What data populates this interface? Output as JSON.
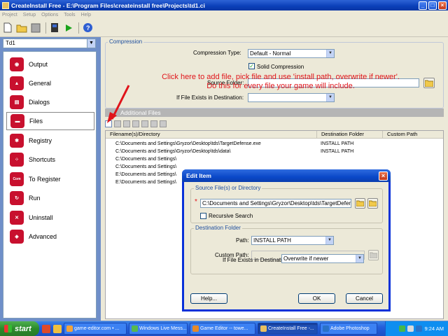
{
  "window": {
    "title": "CreateInstall Free - E:\\Program Files\\createinstall free\\Projects\\td1.ci",
    "minimize": "_",
    "maximize": "□",
    "close": "×"
  },
  "menu": [
    "Project",
    "Setup",
    "Options",
    "Tools",
    "Help"
  ],
  "project_select": {
    "value": "Td1"
  },
  "nav": [
    {
      "label": "Output",
      "icon": "output-icon",
      "color": "#c8102e"
    },
    {
      "label": "General",
      "icon": "general-icon",
      "color": "#c8102e"
    },
    {
      "label": "Dialogs",
      "icon": "dialogs-icon",
      "color": "#c8102e"
    },
    {
      "label": "Files",
      "icon": "files-icon",
      "color": "#c8102e"
    },
    {
      "label": "Registry",
      "icon": "registry-icon",
      "color": "#c8102e"
    },
    {
      "label": "Shortcuts",
      "icon": "shortcuts-icon",
      "color": "#c8102e"
    },
    {
      "label": "To Register",
      "icon": "to-register-icon",
      "color": "#c8102e"
    },
    {
      "label": "Run",
      "icon": "run-icon",
      "color": "#c8102e"
    },
    {
      "label": "Uninstall",
      "icon": "uninstall-icon",
      "color": "#c8102e"
    },
    {
      "label": "Advanced",
      "icon": "advanced-icon",
      "color": "#c8102e"
    }
  ],
  "compression": {
    "legend": "Compression",
    "type_label": "Compression Type:",
    "type_value": "Default - Normal",
    "solid_label": "Solid Compression",
    "solid_checked": "✓",
    "source_folder_label": "Source Folder:",
    "if_exists_label": "If File Exists in Destination:",
    "if_exists_value": ""
  },
  "annotation": {
    "line1": "Click here to add file, pick file and use 'install path, overwrite if newer'.",
    "line2": "Do this for every file your game will include."
  },
  "additional_files": {
    "header": "Additional Files",
    "columns": [
      "Filename(s)/Directory",
      "Destination Folder",
      "Custom Path"
    ],
    "rows": [
      [
        "C:\\Documents and Settings\\Gryzor\\Desktop\\tds\\TargetDefense.exe",
        "INSTALL PATH",
        ""
      ],
      [
        "C:\\Documents and Settings\\Gryzor\\Desktop\\tds\\data\\",
        "INSTALL PATH",
        ""
      ],
      [
        "C:\\Documents and Settings\\",
        "",
        ""
      ],
      [
        "C:\\Documents and Settings\\",
        "",
        ""
      ],
      [
        "E:\\Documents and Settings\\",
        "",
        ""
      ],
      [
        "E:\\Documents and Settings\\",
        "",
        ""
      ]
    ]
  },
  "dialog": {
    "title": "Edit Item",
    "close": "×",
    "source_legend": "Source File(s) or Directory",
    "required_mark": "*",
    "source_value": "C:\\Documents and Settings\\Gryzor\\Desktop\\tds\\TargetDefens",
    "recursive_label": "Recursive Search",
    "dest_legend": "Destination Folder",
    "path_label": "Path:",
    "path_value": "INSTALL PATH",
    "custom_path_label": "Custom Path:",
    "if_exists_label": "If File Exists in Destination",
    "if_exists_value": "Overwrite if newer",
    "help": "Help...",
    "ok": "OK",
    "cancel": "Cancel"
  },
  "taskbar": {
    "start": "start",
    "tasks": [
      {
        "label": "game-editor.com • ...",
        "active": false
      },
      {
        "label": "Windows Live Mess...",
        "active": false
      },
      {
        "label": "Game Editor -- towe...",
        "active": false
      },
      {
        "label": "CreateInstall Free -...",
        "active": true
      },
      {
        "label": "Adobe Photoshop",
        "active": false
      }
    ],
    "clock": "9:24 AM"
  }
}
